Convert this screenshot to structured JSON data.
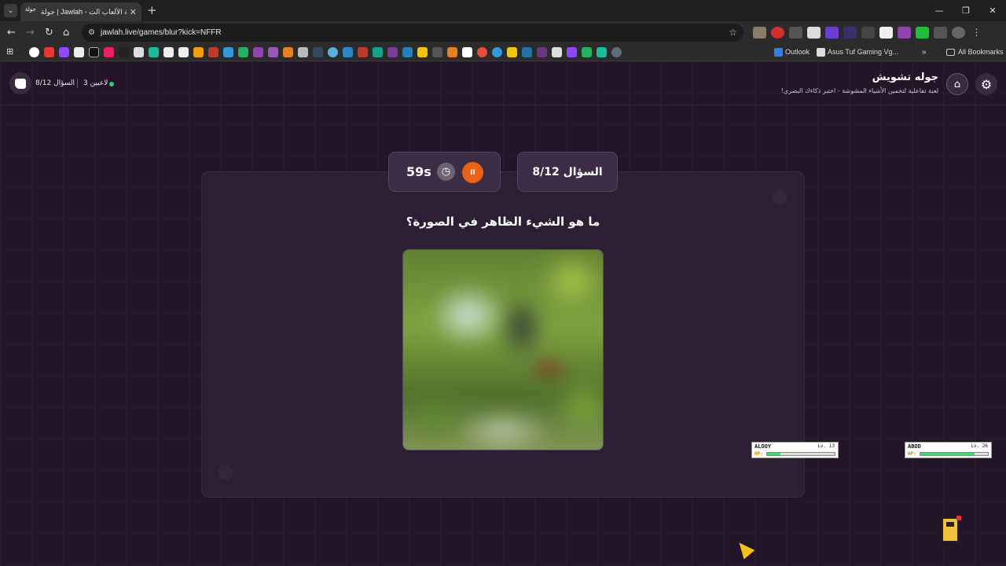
{
  "browser": {
    "tab_title": "جولة | Jawlah - منصة الألعاب الت...",
    "tab_favicon_text": "جولة",
    "url": "jawlah.live/games/blur?kick=NFFR",
    "bookmarks": {
      "outlook": "Outlook",
      "asus": "Asus Tuf Gaming Vg...",
      "all": "All Bookmarks"
    },
    "icons": [
      "tab-search-icon",
      "back-icon",
      "forward-icon",
      "reload-icon",
      "home-icon",
      "site-info-icon",
      "star-icon",
      "extensions-icon",
      "profile-icon",
      "menu-icon",
      "apps-icon"
    ]
  },
  "header": {
    "app_title": "جوله تشويش",
    "app_subtitle": "لعبة تفاعلية لتخمين الأشياء المشوشة - اختبر ذكاءك البصري!",
    "question_counter": "السؤال 8/12",
    "players": "3 لاعبين",
    "online_color": "#2ecc71"
  },
  "game": {
    "question_badge": "السؤال 8/12",
    "timer": "59s",
    "question_text": "ما هو الشيء الظاهر في الصورة؟",
    "accent_color": "#e8621a"
  },
  "players": [
    {
      "name": "ALOOY",
      "level": "Lv. 13",
      "hp_label": "HP:",
      "hp_fraction": 0.2
    },
    {
      "name": "ABOD",
      "level": "Lv. 26",
      "hp_label": "HP:",
      "hp_fraction": 0.8
    }
  ]
}
